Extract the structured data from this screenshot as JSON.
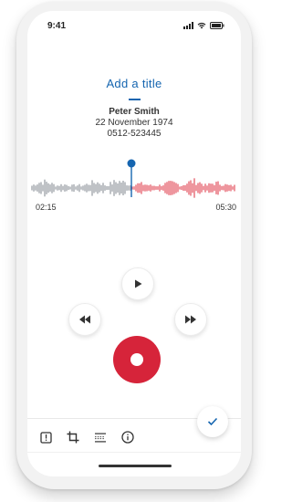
{
  "status_bar": {
    "time": "9:41"
  },
  "recording": {
    "title": "Add a title",
    "contact_name": "Peter Smith",
    "contact_date": "22 November 1974",
    "contact_phone": "0512-523445"
  },
  "player": {
    "current_time": "02:15",
    "total_time": "05:30",
    "progress": 0.5
  },
  "colors": {
    "accent": "#1565b0",
    "played_wave": "#8a9198",
    "remaining_wave": "#e0404f",
    "record": "#d6243a"
  },
  "icons": {
    "play": "play-icon",
    "rewind": "rewind-icon",
    "fast_forward": "fast-forward-icon",
    "record": "record-icon",
    "confirm": "checkmark-icon",
    "priority": "priority-icon",
    "crop": "crop-icon",
    "insert": "insert-icon",
    "info": "info-icon"
  }
}
